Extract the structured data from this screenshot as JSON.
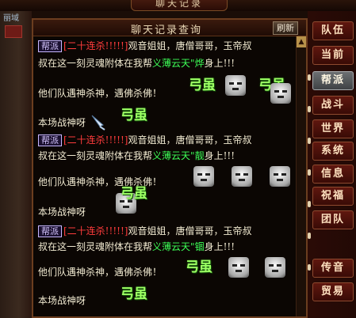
{
  "window": {
    "title": "聊天记录"
  },
  "left_edge": {
    "tag": "丽域"
  },
  "panel": {
    "title": "聊天记录查询",
    "refresh_label": "刷新",
    "messages": [
      {
        "channel": "帮派",
        "announce": "[二十连杀!!!!!]",
        "line1_rest": "观音姐姐，唐僧哥哥，玉帝叔",
        "line2_pre": "叔在这一刻灵魂附体在我帮",
        "guild": "义薄云天",
        "line2_quote": "\"",
        "name": "烨",
        "line2_post": "身上!!!",
        "line3": "他们队遇神杀神，遇佛杀佛！",
        "line4": "本场战神呀",
        "emote_text": "弓虽"
      },
      {
        "channel": "帮派",
        "announce": "[二十连杀!!!!!]",
        "line1_rest": "观音姐姐，唐僧哥哥，玉帝叔",
        "line2_pre": "叔在这一刻灵魂附体在我帮",
        "guild": "义薄云天",
        "line2_quote": "\"",
        "name": "靓",
        "line2_post": "身上!!!",
        "line3": "他们队遇神杀神，遇佛杀佛！",
        "line4": "本场战神呀",
        "emote_text": "弓虽"
      },
      {
        "channel": "帮派",
        "announce": "[二十连杀!!!!!]",
        "line1_rest": "观音姐姐，唐僧哥哥，玉帝叔",
        "line2_pre": "叔在这一刻灵魂附体在我帮",
        "guild": "义薄云天",
        "line2_quote": "\"",
        "name": "锢",
        "line2_post": "身上!!!",
        "line3": "他们队遇神杀神，遇佛杀佛！",
        "line4": "本场战神呀",
        "emote_text": "弓虽"
      }
    ]
  },
  "side_buttons": [
    {
      "label": "队伍",
      "style": "dark"
    },
    {
      "label": "当前",
      "style": "dark"
    },
    {
      "label": "帮派",
      "style": "light"
    },
    {
      "label": "战斗",
      "style": "dark"
    },
    {
      "label": "世界",
      "style": "dark"
    },
    {
      "label": "系统",
      "style": "dark"
    },
    {
      "label": "信息",
      "style": "dark"
    },
    {
      "label": "祝福",
      "style": "dark"
    },
    {
      "label": "团队",
      "style": "dark"
    },
    {
      "label": "传音",
      "style": "dark"
    },
    {
      "label": "贸易",
      "style": "dark"
    }
  ],
  "colors": {
    "announce_red": "#ff3c3c",
    "guild_green": "#3dff57",
    "emote_green": "#9cff63"
  },
  "icons": {
    "emote": "strong-emote-icon",
    "face": "grumpy-face-emote-icon",
    "cursor": "feather-quill-cursor-icon"
  }
}
